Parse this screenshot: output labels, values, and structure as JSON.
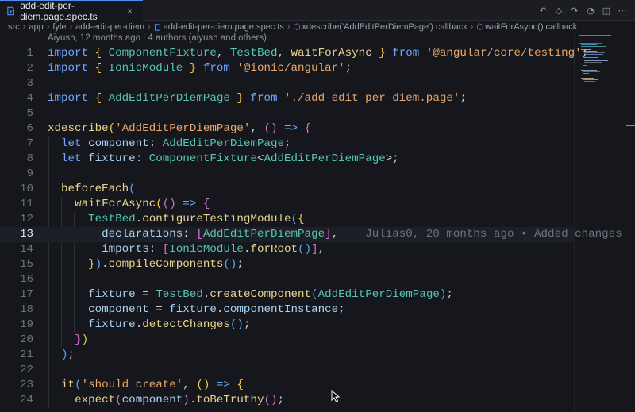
{
  "tab": {
    "label": "add-edit-per-diem.page.spec.ts",
    "close": "×"
  },
  "tab_actions": [
    "↶",
    "◇",
    "↷",
    "◔",
    "◫",
    "⋯"
  ],
  "breadcrumb": {
    "items": [
      "src",
      "app",
      "fyle",
      "add-edit-per-diem"
    ],
    "file": "add-edit-per-diem.page.spec.ts",
    "symbols": [
      "xdescribe('AddEditPerDiemPage') callback",
      "waitForAsync() callback"
    ]
  },
  "blame_header": "Aiyush, 12 months ago | 4 authors (aiyush and others)",
  "inline_blame": "Julias0, 20 months ago • Added changes",
  "current_line": 13,
  "lines": [
    {
      "n": "1",
      "t": [
        [
          "kw",
          "import "
        ],
        [
          "br",
          "{ "
        ],
        [
          "ty",
          "ComponentFixture"
        ],
        [
          "pun",
          ", "
        ],
        [
          "ty",
          "TestBed"
        ],
        [
          "pun",
          ", "
        ],
        [
          "fn",
          "waitForAsync"
        ],
        [
          "br",
          " }"
        ],
        [
          "kw",
          " from "
        ],
        [
          "str",
          "'@angular/core/testing'"
        ],
        [
          "pun",
          ";"
        ]
      ]
    },
    {
      "n": "2",
      "t": [
        [
          "kw",
          "import "
        ],
        [
          "br",
          "{ "
        ],
        [
          "ty",
          "IonicModule"
        ],
        [
          "br",
          " }"
        ],
        [
          "kw",
          " from "
        ],
        [
          "str",
          "'@ionic/angular'"
        ],
        [
          "pun",
          ";"
        ]
      ]
    },
    {
      "n": "3",
      "t": []
    },
    {
      "n": "4",
      "t": [
        [
          "kw",
          "import "
        ],
        [
          "br",
          "{ "
        ],
        [
          "ty",
          "AddEditPerDiemPage"
        ],
        [
          "br",
          " }"
        ],
        [
          "kw",
          " from "
        ],
        [
          "str",
          "'./add-edit-per-diem.page'"
        ],
        [
          "pun",
          ";"
        ]
      ]
    },
    {
      "n": "5",
      "t": []
    },
    {
      "n": "6",
      "t": [
        [
          "fn",
          "xdescribe"
        ],
        [
          "br",
          "("
        ],
        [
          "str",
          "'AddEditPerDiemPage'"
        ],
        [
          "pun",
          ", "
        ],
        [
          "br2",
          "()"
        ],
        [
          "kw",
          " => "
        ],
        [
          "br2",
          "{"
        ]
      ]
    },
    {
      "n": "7",
      "t": [
        [
          "pun",
          "  "
        ],
        [
          "kw",
          "let "
        ],
        [
          "var",
          "component"
        ],
        [
          "pun",
          ": "
        ],
        [
          "ty",
          "AddEditPerDiemPage"
        ],
        [
          "pun",
          ";"
        ]
      ]
    },
    {
      "n": "8",
      "t": [
        [
          "pun",
          "  "
        ],
        [
          "kw",
          "let "
        ],
        [
          "var",
          "fixture"
        ],
        [
          "pun",
          ": "
        ],
        [
          "ty",
          "ComponentFixture"
        ],
        [
          "pun",
          "<"
        ],
        [
          "ty",
          "AddEditPerDiemPage"
        ],
        [
          "pun",
          ">;"
        ]
      ]
    },
    {
      "n": "9",
      "t": []
    },
    {
      "n": "10",
      "t": [
        [
          "pun",
          "  "
        ],
        [
          "fn",
          "beforeEach"
        ],
        [
          "br3",
          "("
        ]
      ]
    },
    {
      "n": "11",
      "t": [
        [
          "pun",
          "    "
        ],
        [
          "fn",
          "waitForAsync"
        ],
        [
          "br",
          "("
        ],
        [
          "br2",
          "()"
        ],
        [
          "kw",
          " => "
        ],
        [
          "br2",
          "{"
        ]
      ]
    },
    {
      "n": "12",
      "t": [
        [
          "pun",
          "      "
        ],
        [
          "ty",
          "TestBed"
        ],
        [
          "pun",
          "."
        ],
        [
          "fn",
          "configureTestingModule"
        ],
        [
          "br3",
          "("
        ],
        [
          "br",
          "{"
        ]
      ]
    },
    {
      "n": "13",
      "t": [
        [
          "pun",
          "        "
        ],
        [
          "pr",
          "declarations"
        ],
        [
          "pun",
          ": "
        ],
        [
          "br2",
          "["
        ],
        [
          "ty",
          "AddEditPerDiemPage"
        ],
        [
          "br2",
          "]"
        ],
        [
          "pun",
          ","
        ]
      ]
    },
    {
      "n": "14",
      "t": [
        [
          "pun",
          "        "
        ],
        [
          "pr",
          "imports"
        ],
        [
          "pun",
          ": "
        ],
        [
          "br2",
          "["
        ],
        [
          "ty",
          "IonicModule"
        ],
        [
          "pun",
          "."
        ],
        [
          "fn",
          "forRoot"
        ],
        [
          "br3",
          "()"
        ],
        [
          "br2",
          "]"
        ],
        [
          "pun",
          ","
        ]
      ]
    },
    {
      "n": "15",
      "t": [
        [
          "pun",
          "      "
        ],
        [
          "br",
          "}"
        ],
        [
          "br3",
          ")"
        ],
        [
          "pun",
          "."
        ],
        [
          "fn",
          "compileComponents"
        ],
        [
          "br3",
          "()"
        ],
        [
          "pun",
          ";"
        ]
      ]
    },
    {
      "n": "16",
      "t": []
    },
    {
      "n": "17",
      "t": [
        [
          "pun",
          "      "
        ],
        [
          "var",
          "fixture"
        ],
        [
          "pun",
          " = "
        ],
        [
          "ty",
          "TestBed"
        ],
        [
          "pun",
          "."
        ],
        [
          "fn",
          "createComponent"
        ],
        [
          "br3",
          "("
        ],
        [
          "ty",
          "AddEditPerDiemPage"
        ],
        [
          "br3",
          ")"
        ],
        [
          "pun",
          ";"
        ]
      ]
    },
    {
      "n": "18",
      "t": [
        [
          "pun",
          "      "
        ],
        [
          "var",
          "component"
        ],
        [
          "pun",
          " = "
        ],
        [
          "var",
          "fixture"
        ],
        [
          "pun",
          "."
        ],
        [
          "var",
          "componentInstance"
        ],
        [
          "pun",
          ";"
        ]
      ]
    },
    {
      "n": "19",
      "t": [
        [
          "pun",
          "      "
        ],
        [
          "var",
          "fixture"
        ],
        [
          "pun",
          "."
        ],
        [
          "fn",
          "detectChanges"
        ],
        [
          "br3",
          "()"
        ],
        [
          "pun",
          ";"
        ]
      ]
    },
    {
      "n": "20",
      "t": [
        [
          "pun",
          "    "
        ],
        [
          "br2",
          "}"
        ],
        [
          "br",
          ")"
        ]
      ]
    },
    {
      "n": "21",
      "t": [
        [
          "pun",
          "  "
        ],
        [
          "br3",
          ")"
        ],
        [
          "pun",
          ";"
        ]
      ]
    },
    {
      "n": "22",
      "t": []
    },
    {
      "n": "23",
      "t": [
        [
          "pun",
          "  "
        ],
        [
          "fn",
          "it"
        ],
        [
          "br3",
          "("
        ],
        [
          "str",
          "'should create'"
        ],
        [
          "pun",
          ", "
        ],
        [
          "br",
          "()"
        ],
        [
          "kw",
          " => "
        ],
        [
          "br",
          "{"
        ]
      ]
    },
    {
      "n": "24",
      "t": [
        [
          "pun",
          "    "
        ],
        [
          "fn",
          "expect"
        ],
        [
          "br2",
          "("
        ],
        [
          "var",
          "component"
        ],
        [
          "br2",
          ")"
        ],
        [
          "pun",
          "."
        ],
        [
          "fn",
          "toBeTruthy"
        ],
        [
          "br2",
          "()"
        ],
        [
          "pun",
          ";"
        ]
      ]
    }
  ],
  "colors": {
    "accent": "#4d8df6",
    "ts_badge": "#3178c6",
    "background": "#16171c"
  },
  "icons": [
    "typescript-file-icon",
    "symbol-method-icon",
    "close-icon",
    "mouse-cursor-icon"
  ]
}
